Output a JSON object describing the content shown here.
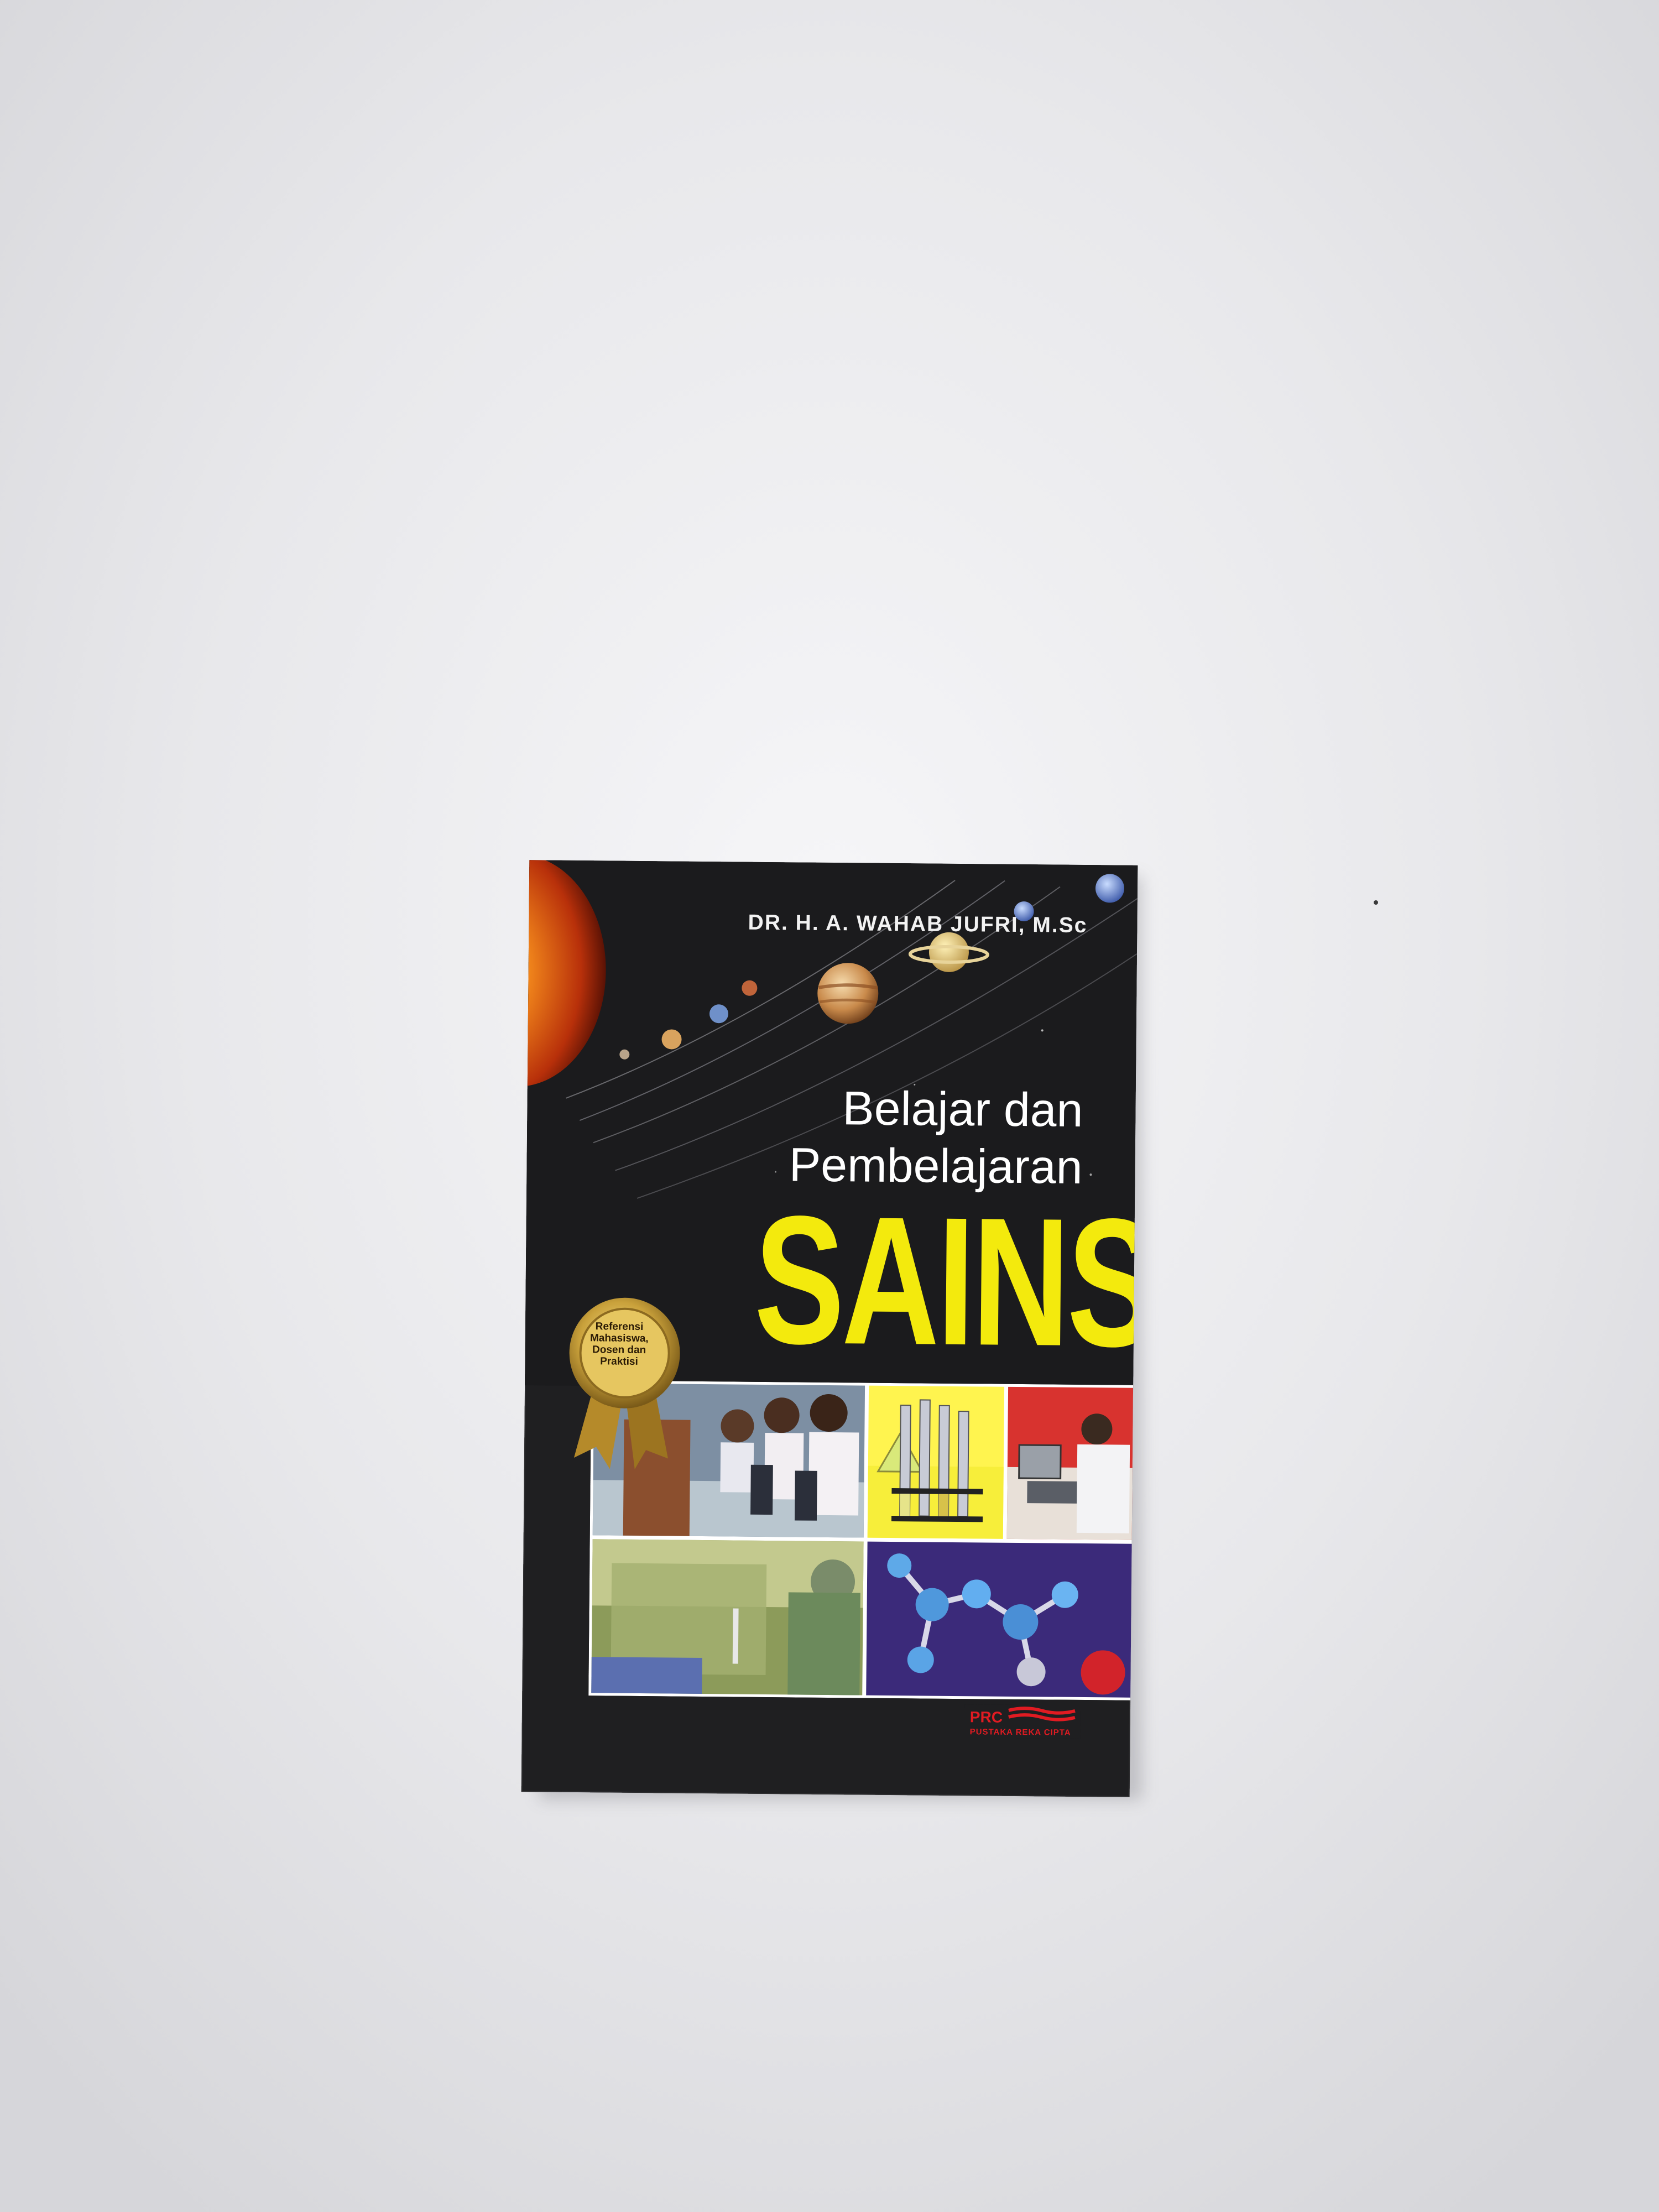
{
  "book": {
    "author": "DR. H. A. WAHAB JUFRI, M.Sc",
    "title_line1": "Belajar dan",
    "title_line2": "Pembelajaran",
    "title_main": "SAINS",
    "badge": {
      "line1": "Referensi",
      "line2": "Mahasiswa,",
      "line3": "Dosen dan",
      "line4": "Praktisi"
    },
    "publisher": {
      "logo": "PRC",
      "name": "PUSTAKA REKA CIPTA"
    }
  },
  "colors": {
    "background": "#e6e6e9",
    "cover": "#1f1f21",
    "title_main": "#f3ea0d",
    "publisher": "#e11b22",
    "medal": "#c9a13b"
  },
  "icons": [
    "solar-system-illustration",
    "award-medal-icon",
    "publisher-logo"
  ]
}
